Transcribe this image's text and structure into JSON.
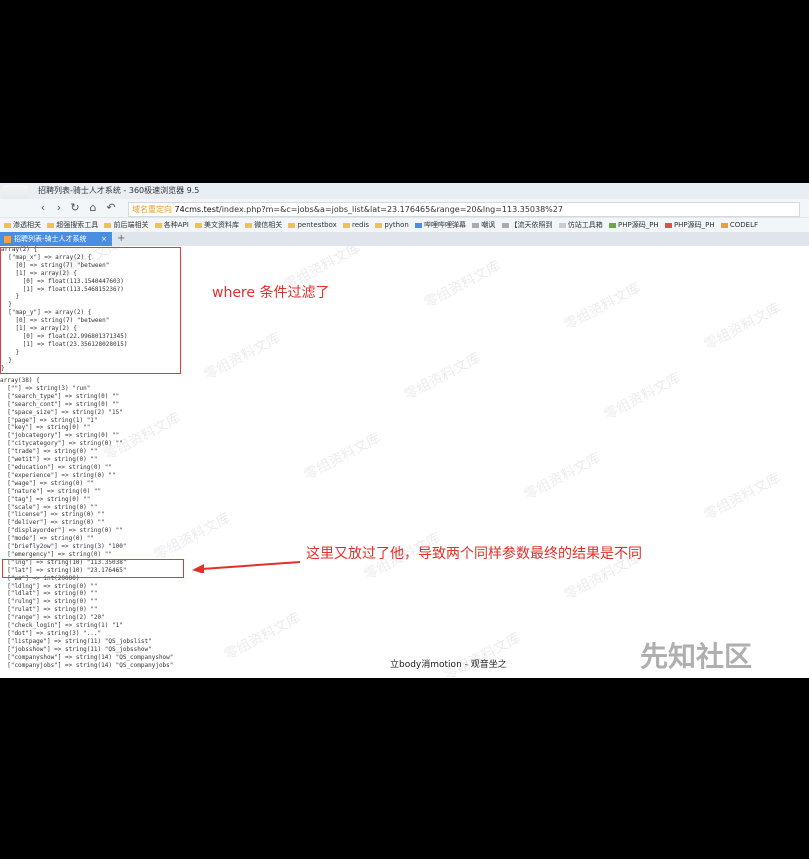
{
  "window": {
    "title": "招聘列表-骑士人才系统 - 360极速浏览器 9.5"
  },
  "address_bar": {
    "hint": "域名重定向",
    "host": "74cms.test",
    "path": "/index.php?m=&c=jobs&a=jobs_list&lat=23.176465&range=20&lng=113.35038%27"
  },
  "bookmarks": [
    "渗透相关",
    "超强搜索工具",
    "前后端相关",
    "各种API",
    "美文资料库",
    "微信相关",
    "pentestbox",
    "redis",
    "python",
    "哔哩哔哩弹幕",
    "嘲讽",
    "【流天依照到",
    "仿站工具箱",
    "PHP源码_PH",
    "PHP源码_PH",
    "CODELF"
  ],
  "tab": {
    "label": "招聘列表-骑士人才系统",
    "close": "×",
    "new_tab": "+"
  },
  "dump1": "array(2) {\n  [\"map_x\"] => array(2) {\n    [0] => string(7) \"between\"\n    [1] => array(2) {\n      [0] => float(113.1540447603)\n      [1] => float(113.546815236?)\n    }\n  }\n  [\"map_y\"] => array(2) {\n    [0] => string(7) \"between\"\n    [1] => array(2) {\n      [0] => float(22.996801371345)\n      [1] => float(23.356128028015)\n    }\n  }\n}",
  "dump2": "array(38) {\n  [\"\"] => string(3) \"run\"\n  [\"search_type\"] => string(0) \"\"\n  [\"search_cont\"] => string(0) \"\"\n  [\"space_size\"] => string(2) \"15\"\n  [\"page\"] => string(1) \"1\"\n  [\"key\"] => string(0) \"\"\n  [\"jobcategory\"] => string(0) \"\"\n  [\"citycategory\"] => string(0) \"\"\n  [\"trade\"] => string(0) \"\"\n  [\"wetit\"] => string(0) \"\"\n  [\"education\"] => string(0) \"\"\n  [\"experience\"] => string(0) \"\"\n  [\"wage\"] => string(0) \"\"\n  [\"nature\"] => string(0) \"\"\n  [\"tag\"] => string(0) \"\"\n  [\"scale\"] => string(0) \"\"\n  [\"license\"] => string(0) \"\"\n  [\"deliver\"] => string(0) \"\"\n  [\"displayorder\"] => string(0) \"\"\n  [\"mode\"] => string(0) \"\"\n  [\"briefly2ow\"] => string(3) \"100\"\n  [\"emergency\"] => string(0) \"\"\n  [\"lng\"] => string(10) \"113.35038\"\n  [\"lat\"] => string(10) \"23.176465\"\n  [\"wa\"] => int(20000)\n  [\"ldlng\"] => string(0) \"\"\n  [\"ldlat\"] => string(0) \"\"\n  [\"rulng\"] => string(0) \"\"\n  [\"rulat\"] => string(0) \"\"\n  [\"range\"] => string(2) \"20\"\n  [\"check_login\"] => string(1) \"1\"\n  [\"dot\"] => string(3) \"...\"\n  [\"listpage\"] => string(11) \"QS_jobslist\"\n  [\"jobsshow\"] => string(11) \"QS_jobsshow\"\n  [\"companyshow\"] => string(14) \"QS_companyshow\"\n  [\"companyjobs\"] => string(14) \"QS_companyjobs\"",
  "annotations": {
    "note1": "where 条件过滤了",
    "note2": "这里又放过了他，导致两个同样参数最终的结果是不同"
  },
  "watermark": "零组资料文库",
  "caption": "立body消motion - 观音坐之",
  "logo": "先知社区",
  "colors": {
    "annotation": "#e0302a",
    "tab": "#4a8ee0"
  }
}
